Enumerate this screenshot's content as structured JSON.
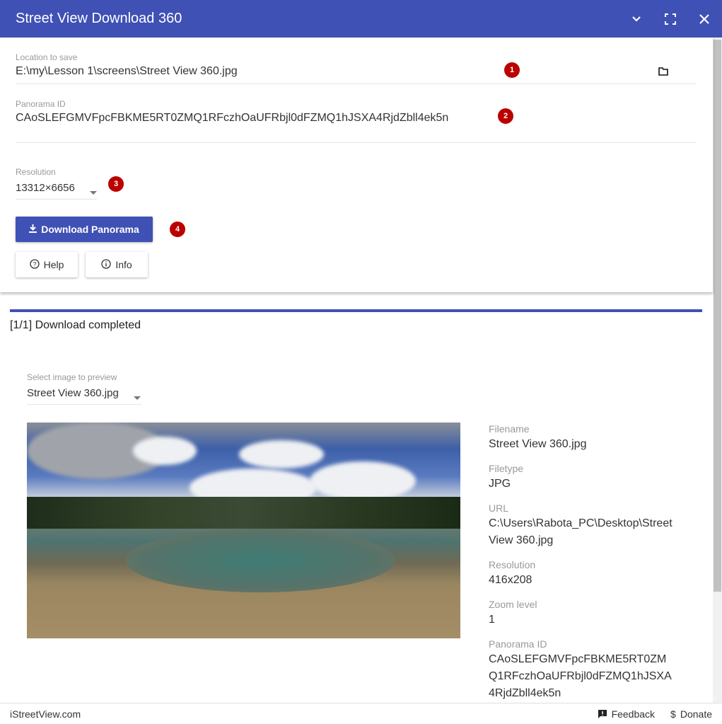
{
  "header": {
    "title": "Street View Download 360",
    "icons": [
      "chevron-down-icon",
      "fullscreen-icon",
      "close-icon"
    ]
  },
  "form": {
    "location": {
      "label": "Location to save",
      "value": "E:\\my\\Lesson 1\\screens\\Street View 360.jpg",
      "badge": "1"
    },
    "panorama": {
      "label": "Panorama ID",
      "value": "CAoSLEFGMVFpcFBKME5RT0ZMQ1RFczhOaUFRbjl0dFZMQ1hJSXA4RjdZbll4ek5n",
      "badge": "2"
    },
    "resolution": {
      "label": "Resolution",
      "value": "13312×6656",
      "badge": "3"
    },
    "download_label": "Download Panorama",
    "download_badge": "4",
    "help_label": "Help",
    "info_label": "Info"
  },
  "progress": {
    "percent": 100,
    "status": "[1/1] Download completed"
  },
  "preview": {
    "label": "Select image to preview",
    "value": "Street View 360.jpg"
  },
  "info": {
    "filename_label": "Filename",
    "filename": "Street View 360.jpg",
    "filetype_label": "Filetype",
    "filetype": "JPG",
    "url_label": "URL",
    "url": "C:\\Users\\Rabota_PC\\Desktop\\Street View 360.jpg",
    "resolution_label": "Resolution",
    "resolution": "416x208",
    "zoom_label": "Zoom level",
    "zoom": "1",
    "pano_label": "Panorama ID",
    "pano": "CAoSLEFGMVFpcFBKME5RT0ZMQ1RFczhOaUFRbjl0dFZMQ1hJSXA4RjdZbll4ek5n"
  },
  "footer": {
    "site": "iStreetView.com",
    "feedback": "Feedback",
    "donate": "Donate"
  },
  "colors": {
    "primary": "#3f51b5",
    "badge": "#bb0000"
  }
}
